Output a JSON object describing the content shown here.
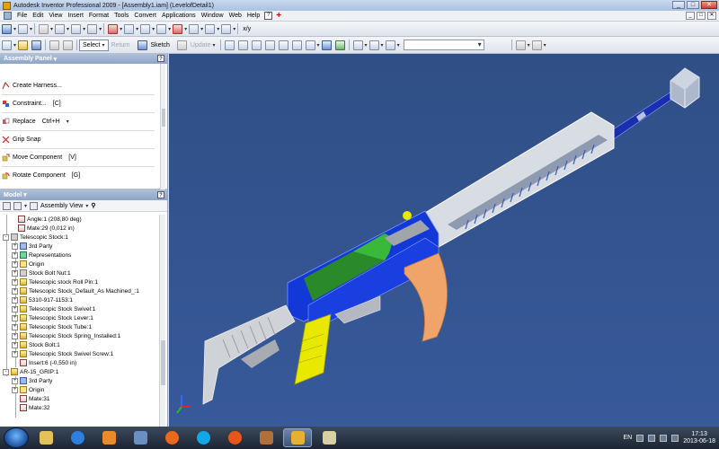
{
  "window": {
    "title": "Autodesk Inventor Professional 2009 - [Assembly1.iam] (LevelofDetail1)",
    "controls": {
      "minimize": "_",
      "maximize": "□",
      "close": "✕"
    }
  },
  "menu": {
    "items": [
      "File",
      "Edit",
      "View",
      "Insert",
      "Format",
      "Tools",
      "Convert",
      "Applications",
      "Window",
      "Web",
      "Help"
    ],
    "help_icon": "?",
    "plus_icon": "+",
    "mdi": [
      "_",
      "□",
      "✕"
    ]
  },
  "toolbar1": {
    "fraction": "x/y"
  },
  "toolbar2": {
    "select": "Select",
    "return": "Return",
    "sketch": "Sketch",
    "update": "Update"
  },
  "assembly_panel": {
    "title": "Assembly Panel",
    "help": "?",
    "items": [
      {
        "label": "Create Harness...",
        "shortcut": ""
      },
      {
        "label": "Constraint...",
        "shortcut": "[C]"
      },
      {
        "label": "Replace",
        "shortcut": "Ctrl+H"
      },
      {
        "label": "Grip Snap",
        "shortcut": ""
      },
      {
        "label": "Move Component",
        "shortcut": "[V]"
      },
      {
        "label": "Rotate Component",
        "shortcut": "[G]"
      }
    ]
  },
  "model": {
    "title": "Model",
    "help": "?",
    "view_label": "Assembly View",
    "tree": [
      {
        "label": "Angle:1 (208,80 deg)",
        "exp": ""
      },
      {
        "label": "Mate:29 (0,012 in)",
        "exp": ""
      },
      {
        "label": "Telescopic Stock:1",
        "exp": "-"
      },
      {
        "label": "3rd Party",
        "exp": "+"
      },
      {
        "label": "Representations",
        "exp": "+"
      },
      {
        "label": "Origin",
        "exp": "+"
      },
      {
        "label": "Stock Bolt Nut:1",
        "exp": "+"
      },
      {
        "label": "Telescopic stock Roll Pin:1",
        "exp": "+"
      },
      {
        "label": "Telescopic Stock_Default_As Machined_:1",
        "exp": "+"
      },
      {
        "label": "5310-917-1153:1",
        "exp": "+"
      },
      {
        "label": "Telescopic Stock Swivel:1",
        "exp": "+"
      },
      {
        "label": "Telescopic Stock Lever:1",
        "exp": "+"
      },
      {
        "label": "Telescopic Stock Tube:1",
        "exp": "+"
      },
      {
        "label": "Telescopic Stock Spring_Installed:1",
        "exp": "+"
      },
      {
        "label": "Stock Bolt:1",
        "exp": "+"
      },
      {
        "label": "Telescopic Stock Swivel Screw:1",
        "exp": "+"
      },
      {
        "label": "Insert:6 (-0,550 in)",
        "exp": ""
      },
      {
        "label": "AR-15_GRIP:1",
        "exp": "-"
      },
      {
        "label": "3rd Party",
        "exp": "+"
      },
      {
        "label": "Origin",
        "exp": "+"
      },
      {
        "label": "Mate:31",
        "exp": ""
      },
      {
        "label": "Mate:32",
        "exp": ""
      }
    ]
  },
  "taskbar": {
    "language": "EN",
    "time": "17:13",
    "date": "2013-06-18"
  },
  "colors": {
    "viewport_bg": "#34548f",
    "receiver_blue": "#1238d8",
    "handguard_white": "#e0e4ea",
    "magazine_orange": "#f0a46a",
    "grip_yellow": "#e8e800",
    "stock_grey": "#c8c8c8",
    "accent_green": "#3ab83a"
  }
}
